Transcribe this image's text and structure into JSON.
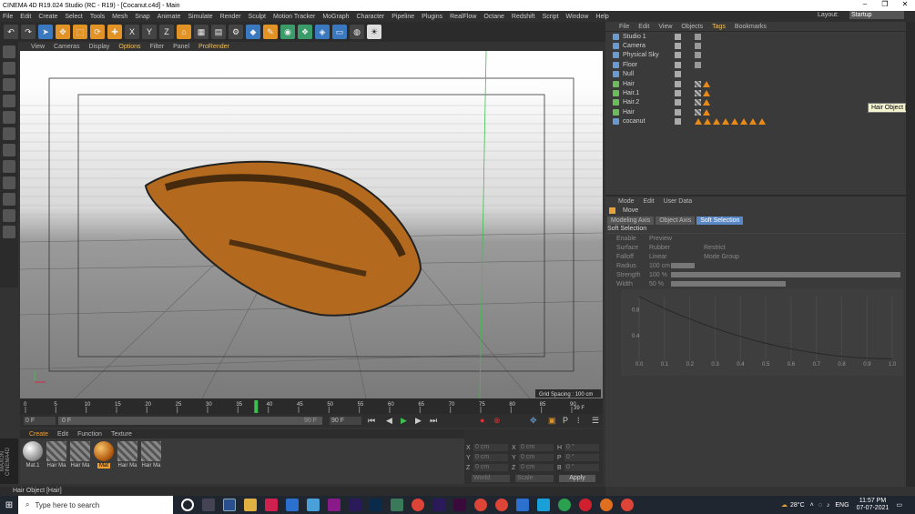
{
  "window": {
    "title": "CINEMA 4D R19.024 Studio (RC - R19) - [Cocanut.c4d] - Main"
  },
  "menu": [
    "File",
    "Edit",
    "Create",
    "Select",
    "Tools",
    "Mesh",
    "Snap",
    "Animate",
    "Simulate",
    "Render",
    "Sculpt",
    "Motion Tracker",
    "MoGraph",
    "Character",
    "Pipeline",
    "Plugins",
    "RealFlow",
    "Octane",
    "Redshift",
    "Script",
    "Window",
    "Help"
  ],
  "layout": {
    "label": "Layout:",
    "value": "Startup"
  },
  "viewport": {
    "menu": [
      "View",
      "Cameras",
      "Display",
      "Options",
      "Filter",
      "Panel",
      "ProRender"
    ],
    "grid_spacing": "Grid Spacing : 100 cm"
  },
  "timeline": {
    "ticks": [
      "0",
      "5",
      "10",
      "15",
      "20",
      "25",
      "30",
      "35",
      "40",
      "45",
      "50",
      "55",
      "60",
      "65",
      "70",
      "75",
      "80",
      "85",
      "90"
    ],
    "current_marker": "38",
    "frame_readout": "39 F",
    "start_field": "0 F",
    "start_field2": "0 F",
    "end_field": "90 F",
    "end_field2": "90 F"
  },
  "material_manager": {
    "menu": [
      "Create",
      "Edit",
      "Function",
      "Texture"
    ],
    "materials": [
      {
        "name": "Mat.1",
        "kind": "sphere"
      },
      {
        "name": "Hair Ma",
        "kind": "hair"
      },
      {
        "name": "Hair Ma",
        "kind": "hair"
      },
      {
        "name": "Mat",
        "kind": "orange"
      },
      {
        "name": "Hair Ma",
        "kind": "hair"
      },
      {
        "name": "Hair Ma",
        "kind": "hair"
      }
    ]
  },
  "coordinates": {
    "rows": [
      {
        "a": "X",
        "v1": "0 cm",
        "b": "X",
        "v2": "0 cm",
        "c": "H",
        "v3": "0 °"
      },
      {
        "a": "Y",
        "v1": "0 cm",
        "b": "Y",
        "v2": "0 cm",
        "c": "P",
        "v3": "0 °"
      },
      {
        "a": "Z",
        "v1": "0 cm",
        "b": "Z",
        "v2": "0 cm",
        "c": "B",
        "v3": "0 °"
      }
    ],
    "mode1": "World",
    "mode2": "Scale",
    "apply": "Apply"
  },
  "status": "Hair Object [Hair]",
  "object_manager": {
    "menu": [
      "File",
      "Edit",
      "View",
      "Objects",
      "Tags",
      "Bookmarks"
    ],
    "objects": [
      {
        "name": "Studio 1",
        "icon": "b"
      },
      {
        "name": "Camera",
        "icon": "b"
      },
      {
        "name": "Physical Sky",
        "icon": "b"
      },
      {
        "name": "Floor",
        "icon": "b"
      },
      {
        "name": "Null",
        "icon": "b"
      },
      {
        "name": "Hair",
        "icon": "g"
      },
      {
        "name": "Hair.1",
        "icon": "g"
      },
      {
        "name": "Hair.2",
        "icon": "g"
      },
      {
        "name": "Hair",
        "icon": "g"
      },
      {
        "name": "cocanut",
        "icon": "b"
      }
    ],
    "tooltip": "Hair Object [Hair]"
  },
  "attributes": {
    "menu": [
      "Mode",
      "Edit",
      "User Data"
    ],
    "tool": "Move",
    "tabs": [
      "Modeling Axis",
      "Object Axis",
      "Soft Selection"
    ],
    "section": "Soft Selection",
    "props": [
      {
        "label": "Enable",
        "extra1": "Preview",
        "extra2": ""
      },
      {
        "label": "Surface",
        "extra1": "Rubber",
        "extra2": "Restrict"
      },
      {
        "label": "Falloff",
        "extra1": "Linear",
        "extra2": "Mode  Group"
      },
      {
        "label": "Radius",
        "extra1": "100 cm",
        "extra2": ""
      },
      {
        "label": "Strength",
        "extra1": "100 %",
        "extra2": ""
      },
      {
        "label": "Width",
        "extra1": "50 %",
        "extra2": ""
      }
    ],
    "graph_x": [
      "0.0",
      "0.1",
      "0.2",
      "0.3",
      "0.4",
      "0.5",
      "0.6",
      "0.7",
      "0.8",
      "0.9",
      "1.0"
    ],
    "graph_y": [
      "0.8",
      "0.4"
    ]
  },
  "taskbar": {
    "search": "Type here to search",
    "temp": "28°C",
    "lang": "ENG",
    "time": "11:57 PM",
    "date": "07-07-2021"
  },
  "colors": {
    "accent": "#e19326",
    "blue": "#3a79c0",
    "panel": "#3a3a3a"
  }
}
